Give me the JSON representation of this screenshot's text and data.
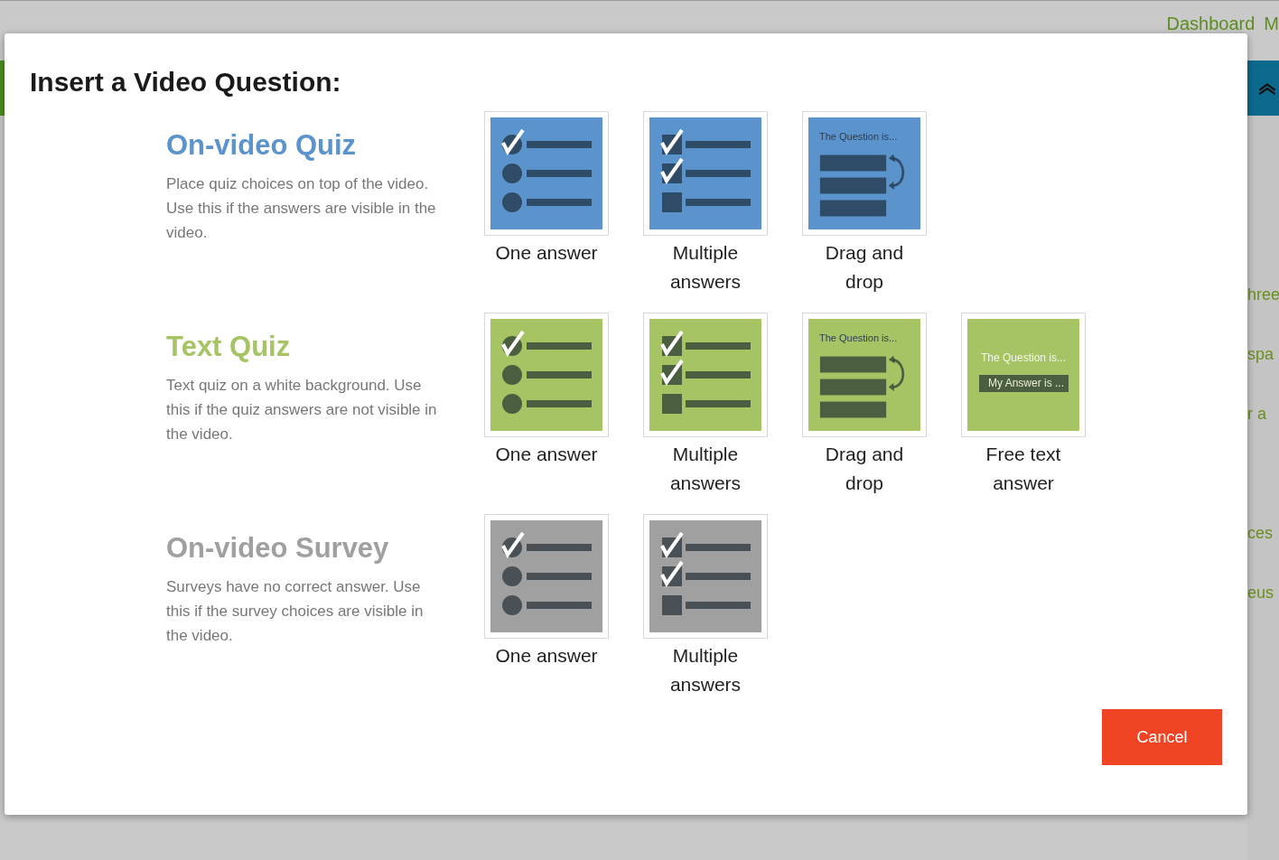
{
  "background": {
    "nav": [
      "Dashboard",
      "M"
    ],
    "fragments": [
      "hree",
      "spa",
      "r a",
      "ces",
      "eus"
    ]
  },
  "dialog": {
    "title": "Insert a Video Question:",
    "sections": [
      {
        "title": "On-video Quiz",
        "color": "#5b93cc",
        "description": "Place quiz choices on top of the video. Use this if the answers are visible in the video.",
        "options": [
          {
            "kind": "single",
            "label": "One answer"
          },
          {
            "kind": "multiple",
            "label": "Multiple answers"
          },
          {
            "kind": "dragdrop",
            "label": "Drag and drop",
            "caption": "The Question is..."
          }
        ]
      },
      {
        "title": "Text Quiz",
        "color": "#a6c464",
        "description": "Text quiz on a white background. Use this if the quiz answers are not visible in the video.",
        "options": [
          {
            "kind": "single",
            "label": "One answer"
          },
          {
            "kind": "multiple",
            "label": "Multiple answers"
          },
          {
            "kind": "dragdrop",
            "label": "Drag and drop",
            "caption": "The Question is..."
          },
          {
            "kind": "freetext",
            "label": "Free text answer",
            "caption": "The Question is...",
            "answer": "My Answer is ..."
          }
        ]
      },
      {
        "title": "On-video Survey",
        "color": "#a0a0a0",
        "description": "Surveys have no correct answer. Use this if the survey choices are visible in the video.",
        "options": [
          {
            "kind": "single",
            "label": "One answer"
          },
          {
            "kind": "multiple",
            "label": "Multiple answers"
          }
        ]
      }
    ],
    "cancel": "Cancel"
  }
}
